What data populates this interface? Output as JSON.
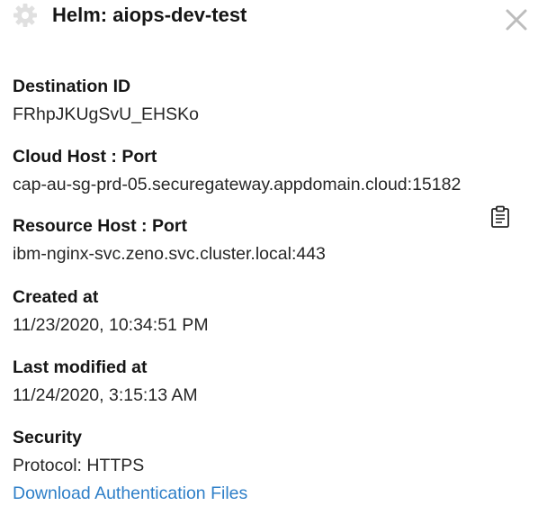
{
  "panel": {
    "title": "Helm: aiops-dev-test"
  },
  "fields": {
    "destination_id": {
      "label": "Destination ID",
      "value": "FRhpJKUgSvU_EHSKo"
    },
    "cloud_host": {
      "label": "Cloud Host : Port",
      "value": "cap-au-sg-prd-05.securegateway.appdomain.cloud:15182"
    },
    "resource_host": {
      "label": "Resource Host : Port",
      "value": "ibm-nginx-svc.zeno.svc.cluster.local:443"
    },
    "created_at": {
      "label": "Created at",
      "value": "11/23/2020, 10:34:51 PM"
    },
    "last_modified": {
      "label": "Last modified at",
      "value": "11/24/2020, 3:15:13 AM"
    },
    "security": {
      "label": "Security",
      "protocol": "Protocol: HTTPS",
      "download_link": "Download Authentication Files"
    }
  },
  "icons": {
    "gear": "gear-icon",
    "close": "close-icon",
    "copy": "clipboard-icon"
  },
  "colors": {
    "link": "#2e7fc8",
    "gear": "#e0e0e0",
    "close": "#bdbdbd"
  }
}
